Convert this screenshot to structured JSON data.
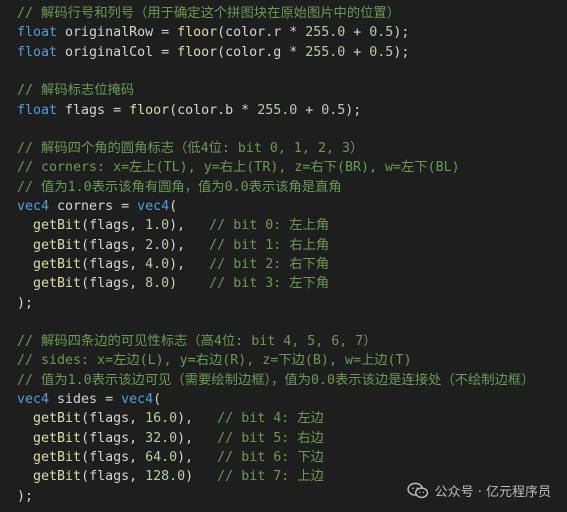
{
  "colors": {
    "background": "#1e1e1e",
    "comment": "#6a9955",
    "keyword": "#569cd6",
    "function": "#dcdcaa",
    "number": "#b5cea8",
    "text": "#d4d4d4"
  },
  "code": {
    "lines": [
      [
        {
          "t": "comment",
          "v": "// 解码行号和列号（用于确定这个拼图块在原始图片中的位置）"
        }
      ],
      [
        {
          "t": "keyword",
          "v": "float"
        },
        {
          "t": "var",
          "v": " originalRow = "
        },
        {
          "t": "func",
          "v": "floor"
        },
        {
          "t": "punct",
          "v": "(color.r * "
        },
        {
          "t": "num",
          "v": "255.0"
        },
        {
          "t": "punct",
          "v": " + "
        },
        {
          "t": "num",
          "v": "0.5"
        },
        {
          "t": "punct",
          "v": ");"
        }
      ],
      [
        {
          "t": "keyword",
          "v": "float"
        },
        {
          "t": "var",
          "v": " originalCol = "
        },
        {
          "t": "func",
          "v": "floor"
        },
        {
          "t": "punct",
          "v": "(color.g * "
        },
        {
          "t": "num",
          "v": "255.0"
        },
        {
          "t": "punct",
          "v": " + "
        },
        {
          "t": "num",
          "v": "0.5"
        },
        {
          "t": "punct",
          "v": ");"
        }
      ],
      [],
      [
        {
          "t": "comment",
          "v": "// 解码标志位掩码"
        }
      ],
      [
        {
          "t": "keyword",
          "v": "float"
        },
        {
          "t": "var",
          "v": " flags = "
        },
        {
          "t": "func",
          "v": "floor"
        },
        {
          "t": "punct",
          "v": "(color.b * "
        },
        {
          "t": "num",
          "v": "255.0"
        },
        {
          "t": "punct",
          "v": " + "
        },
        {
          "t": "num",
          "v": "0.5"
        },
        {
          "t": "punct",
          "v": ");"
        }
      ],
      [],
      [
        {
          "t": "comment",
          "v": "// 解码四个角的圆角标志（低4位: bit 0, 1, 2, 3）"
        }
      ],
      [
        {
          "t": "comment",
          "v": "// corners: x=左上(TL), y=右上(TR), z=右下(BR), w=左下(BL)"
        }
      ],
      [
        {
          "t": "comment",
          "v": "// 值为1.0表示该角有圆角，值为0.0表示该角是直角"
        }
      ],
      [
        {
          "t": "keyword",
          "v": "vec4"
        },
        {
          "t": "var",
          "v": " corners = "
        },
        {
          "t": "keyword",
          "v": "vec4"
        },
        {
          "t": "punct",
          "v": "("
        }
      ],
      [
        {
          "t": "var",
          "v": "  "
        },
        {
          "t": "func",
          "v": "getBit"
        },
        {
          "t": "punct",
          "v": "(flags, "
        },
        {
          "t": "num",
          "v": "1.0"
        },
        {
          "t": "punct",
          "v": "),   "
        },
        {
          "t": "comment",
          "v": "// bit 0: 左上角"
        }
      ],
      [
        {
          "t": "var",
          "v": "  "
        },
        {
          "t": "func",
          "v": "getBit"
        },
        {
          "t": "punct",
          "v": "(flags, "
        },
        {
          "t": "num",
          "v": "2.0"
        },
        {
          "t": "punct",
          "v": "),   "
        },
        {
          "t": "comment",
          "v": "// bit 1: 右上角"
        }
      ],
      [
        {
          "t": "var",
          "v": "  "
        },
        {
          "t": "func",
          "v": "getBit"
        },
        {
          "t": "punct",
          "v": "(flags, "
        },
        {
          "t": "num",
          "v": "4.0"
        },
        {
          "t": "punct",
          "v": "),   "
        },
        {
          "t": "comment",
          "v": "// bit 2: 右下角"
        }
      ],
      [
        {
          "t": "var",
          "v": "  "
        },
        {
          "t": "func",
          "v": "getBit"
        },
        {
          "t": "punct",
          "v": "(flags, "
        },
        {
          "t": "num",
          "v": "8.0"
        },
        {
          "t": "punct",
          "v": ")    "
        },
        {
          "t": "comment",
          "v": "// bit 3: 左下角"
        }
      ],
      [
        {
          "t": "punct",
          "v": ");"
        }
      ],
      [],
      [
        {
          "t": "comment",
          "v": "// 解码四条边的可见性标志（高4位: bit 4, 5, 6, 7）"
        }
      ],
      [
        {
          "t": "comment",
          "v": "// sides: x=左边(L), y=右边(R), z=下边(B), w=上边(T)"
        }
      ],
      [
        {
          "t": "comment",
          "v": "// 值为1.0表示该边可见（需要绘制边框），值为0.0表示该边是连接处（不绘制边框）"
        }
      ],
      [
        {
          "t": "keyword",
          "v": "vec4"
        },
        {
          "t": "var",
          "v": " sides = "
        },
        {
          "t": "keyword",
          "v": "vec4"
        },
        {
          "t": "punct",
          "v": "("
        }
      ],
      [
        {
          "t": "var",
          "v": "  "
        },
        {
          "t": "func",
          "v": "getBit"
        },
        {
          "t": "punct",
          "v": "(flags, "
        },
        {
          "t": "num",
          "v": "16.0"
        },
        {
          "t": "punct",
          "v": "),   "
        },
        {
          "t": "comment",
          "v": "// bit 4: 左边"
        }
      ],
      [
        {
          "t": "var",
          "v": "  "
        },
        {
          "t": "func",
          "v": "getBit"
        },
        {
          "t": "punct",
          "v": "(flags, "
        },
        {
          "t": "num",
          "v": "32.0"
        },
        {
          "t": "punct",
          "v": "),   "
        },
        {
          "t": "comment",
          "v": "// bit 5: 右边"
        }
      ],
      [
        {
          "t": "var",
          "v": "  "
        },
        {
          "t": "func",
          "v": "getBit"
        },
        {
          "t": "punct",
          "v": "(flags, "
        },
        {
          "t": "num",
          "v": "64.0"
        },
        {
          "t": "punct",
          "v": "),   "
        },
        {
          "t": "comment",
          "v": "// bit 6: 下边"
        }
      ],
      [
        {
          "t": "var",
          "v": "  "
        },
        {
          "t": "func",
          "v": "getBit"
        },
        {
          "t": "punct",
          "v": "(flags, "
        },
        {
          "t": "num",
          "v": "128.0"
        },
        {
          "t": "punct",
          "v": ")   "
        },
        {
          "t": "comment",
          "v": "// bit 7: 上边"
        }
      ],
      [
        {
          "t": "punct",
          "v": ");"
        }
      ]
    ]
  },
  "watermark": {
    "icon": "wechat-icon",
    "text": "公众号 · 亿元程序员"
  }
}
